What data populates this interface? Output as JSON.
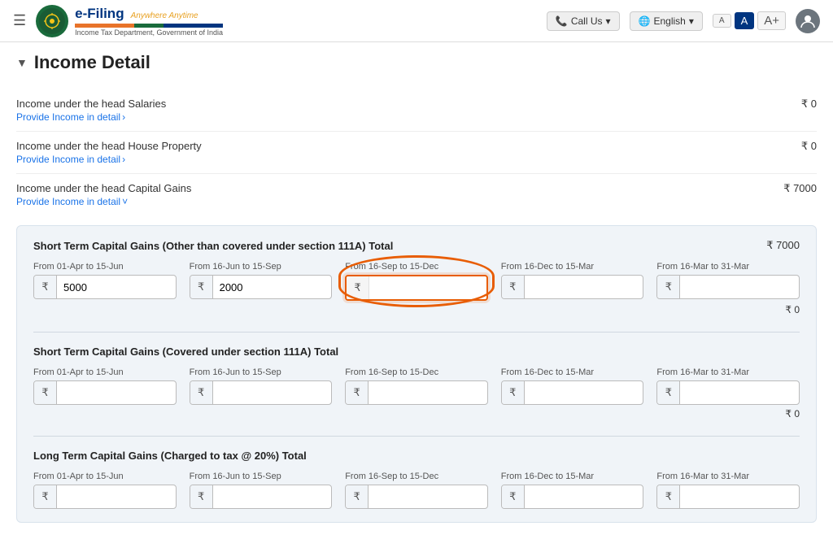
{
  "header": {
    "menu_icon": "☰",
    "brand_name": "e-Filing",
    "brand_tagline": "Anywhere Anytime",
    "gov_label": "Income Tax Department, Government of India",
    "call_us": "Call Us",
    "language": "English",
    "font_small": "A",
    "font_medium": "A",
    "font_large": "A+",
    "avatar_label": "U"
  },
  "page": {
    "section_title": "Income Detail",
    "income_rows": [
      {
        "label": "Income under the head Salaries",
        "link_text": "Provide Income in detail",
        "link_arrow": "›",
        "amount": "₹ 0"
      },
      {
        "label": "Income under the head House Property",
        "link_text": "Provide Income in detail",
        "link_arrow": "›",
        "amount": "₹ 0"
      },
      {
        "label": "Income under the head Capital Gains",
        "link_text": "Provide Income in detail",
        "link_arrow": "˅",
        "amount": "₹ 7000"
      }
    ],
    "capital_panel": {
      "sections": [
        {
          "title": "Short Term Capital Gains (Other than covered under section 111A) Total",
          "total": "₹ 7000",
          "subtotal": "₹ 0",
          "fields": [
            {
              "label": "From 01-Apr to 15-Jun",
              "value": "5000",
              "placeholder": "",
              "highlighted": false
            },
            {
              "label": "From 16-Jun to 15-Sep",
              "value": "2000",
              "placeholder": "",
              "highlighted": false
            },
            {
              "label": "From 16-Sep to 15-Dec",
              "value": "",
              "placeholder": "",
              "highlighted": true
            },
            {
              "label": "From 16-Dec to 15-Mar",
              "value": "",
              "placeholder": "",
              "highlighted": false
            },
            {
              "label": "From 16-Mar to 31-Mar",
              "value": "",
              "placeholder": "",
              "highlighted": false
            }
          ]
        },
        {
          "title": "Short Term Capital Gains (Covered under section 111A) Total",
          "total": "",
          "subtotal": "₹ 0",
          "fields": [
            {
              "label": "From 01-Apr to 15-Jun",
              "value": "",
              "placeholder": "",
              "highlighted": false
            },
            {
              "label": "From 16-Jun to 15-Sep",
              "value": "",
              "placeholder": "",
              "highlighted": false
            },
            {
              "label": "From 16-Sep to 15-Dec",
              "value": "",
              "placeholder": "",
              "highlighted": false
            },
            {
              "label": "From 16-Dec to 15-Mar",
              "value": "",
              "placeholder": "",
              "highlighted": false
            },
            {
              "label": "From 16-Mar to 31-Mar",
              "value": "",
              "placeholder": "",
              "highlighted": false
            }
          ]
        },
        {
          "title": "Long Term Capital Gains (Charged to tax @ 20%) Total",
          "total": "",
          "subtotal": "",
          "fields": [
            {
              "label": "From 01-Apr to 15-Jun",
              "value": "",
              "placeholder": "",
              "highlighted": false
            },
            {
              "label": "From 16-Jun to 15-Sep",
              "value": "",
              "placeholder": "",
              "highlighted": false
            },
            {
              "label": "From 16-Sep to 15-Dec",
              "value": "",
              "placeholder": "",
              "highlighted": false
            },
            {
              "label": "From 16-Dec to 15-Mar",
              "value": "",
              "placeholder": "",
              "highlighted": false
            },
            {
              "label": "From 16-Mar to 31-Mar",
              "value": "",
              "placeholder": "",
              "highlighted": false
            }
          ]
        }
      ]
    }
  }
}
